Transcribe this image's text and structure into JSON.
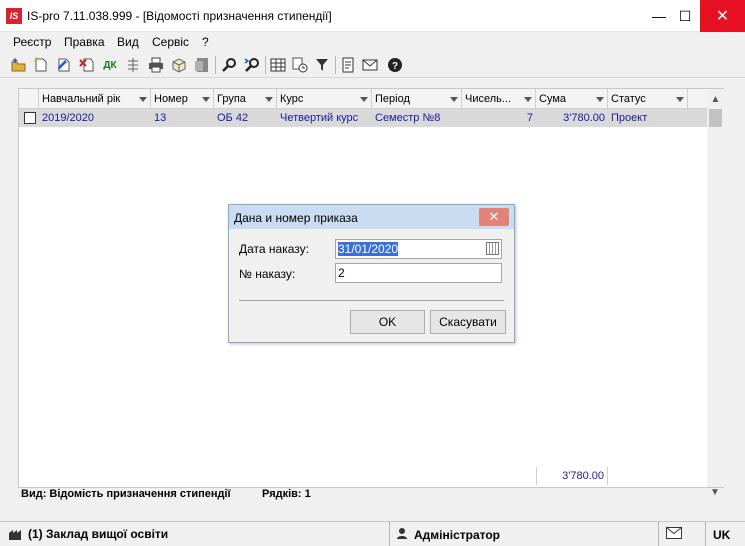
{
  "window": {
    "logo_text": "IS",
    "title": "IS-pro 7.11.038.999 - [Відомості призначення стипендії]",
    "min_glyph": "—",
    "max_glyph": "☐",
    "close_glyph": "✕"
  },
  "menu": [
    "Реєстр",
    "Правка",
    "Вид",
    "Сервіс",
    "?"
  ],
  "toolbar": {
    "icons": [
      "open-icon",
      "new-icon",
      "edit-icon",
      "delete-icon",
      "dk-icon",
      "split-icon",
      "print-icon",
      "package-icon",
      "export-icon",
      "search-icon",
      "search-next-icon",
      "table-icon",
      "history-icon",
      "filter-icon",
      "document-icon",
      "mail-icon",
      "help-icon"
    ],
    "dk_label": "ДК"
  },
  "grid": {
    "columns": [
      "Навчальний рік",
      "Номер",
      "Група",
      "Курс",
      "Період",
      "Чисель...",
      "Сума",
      "Статус"
    ],
    "rows": [
      {
        "year": "2019/2020",
        "number": "13",
        "group": "ОБ 42",
        "course": "Четвертий курс",
        "period": "Семестр  №8",
        "count": "7",
        "sum": "3'780.00",
        "status": "Проект"
      }
    ],
    "total_sum": "3'780.00"
  },
  "info": {
    "view_label": "Вид: Відомість призначення стипендії",
    "rows_label": "Рядків: 1"
  },
  "status": {
    "org": "(1) Заклад вищої освіти",
    "user": "Адміністратор",
    "lang": "UK"
  },
  "dialog": {
    "title": "Дана и номер приказа",
    "close_glyph": "✕",
    "date_label": "Дата наказу:",
    "date_value": "31/01/2020",
    "number_label": "№ наказу:",
    "number_value": "2",
    "ok_label": "OK",
    "cancel_label": "Скасувати"
  }
}
